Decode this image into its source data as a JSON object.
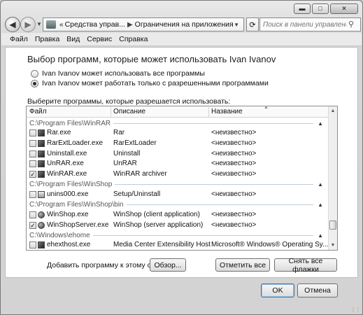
{
  "window": {
    "caption_buttons": [
      "minimize",
      "maximize",
      "close"
    ]
  },
  "nav": {
    "back_icon": "back-arrow-icon",
    "forward_icon": "forward-arrow-icon",
    "breadcrumb_prefix": "«",
    "breadcrumb": [
      "Средства управ...",
      "Ограничения на приложения"
    ],
    "search_placeholder": "Поиск в панели управления"
  },
  "menu": [
    "Файл",
    "Правка",
    "Вид",
    "Сервис",
    "Справка"
  ],
  "main": {
    "heading": "Выбор программ, которые может использовать Ivan Ivanov",
    "radio_all": "Ivan Ivanov может использовать все программы",
    "radio_allowed": "Ivan Ivanov может работать только с разрешенными программами",
    "selected_radio": "radio_allowed",
    "list_caption": "Выберите программы, которые разрешается использовать:",
    "columns": [
      "Файл",
      "Описание",
      "Название"
    ],
    "groups": [
      {
        "path": "C:\\Program Files\\WinRAR",
        "rows": [
          {
            "file": "Rar.exe",
            "desc": "Rar",
            "name": "<неизвестно>",
            "checked": false,
            "icon": "app"
          },
          {
            "file": "RarExtLoader.exe",
            "desc": "RarExtLoader",
            "name": "<неизвестно>",
            "checked": false,
            "icon": "app"
          },
          {
            "file": "Uninstall.exe",
            "desc": "Uninstall",
            "name": "<неизвестно>",
            "checked": false,
            "icon": "app"
          },
          {
            "file": "UnRAR.exe",
            "desc": "UnRAR",
            "name": "<неизвестно>",
            "checked": false,
            "icon": "app"
          },
          {
            "file": "WinRAR.exe",
            "desc": "WinRAR archiver",
            "name": "<неизвестно>",
            "checked": true,
            "icon": "app"
          }
        ]
      },
      {
        "path": "C:\\Program Files\\WinShop",
        "rows": [
          {
            "file": "unins000.exe",
            "desc": "Setup/Uninstall",
            "name": "<неизвестно>",
            "checked": false,
            "icon": "setup"
          }
        ]
      },
      {
        "path": "C:\\Program Files\\WinShop\\bin",
        "rows": [
          {
            "file": "WinShop.exe",
            "desc": "WinShop (client application)",
            "name": "<неизвестно>",
            "checked": false,
            "icon": "globe"
          },
          {
            "file": "WinShopServer.exe",
            "desc": "WinShop (server application)",
            "name": "<неизвестно>",
            "checked": true,
            "icon": "globe"
          }
        ]
      },
      {
        "path": "C:\\Windows\\ehome",
        "rows": [
          {
            "file": "ehexthost.exe",
            "desc": "Media Center Extensibility Host",
            "name": "Microsoft® Windows® Operating Sy...",
            "checked": false,
            "icon": "app"
          }
        ]
      }
    ],
    "add_label": "Добавить программу к этому списку:",
    "browse_button": "Обзор...",
    "check_all_button": "Отметить все",
    "uncheck_all_button": "Снять все флажки"
  },
  "footer": {
    "ok_button": "OK",
    "cancel_button": "Отмена"
  }
}
